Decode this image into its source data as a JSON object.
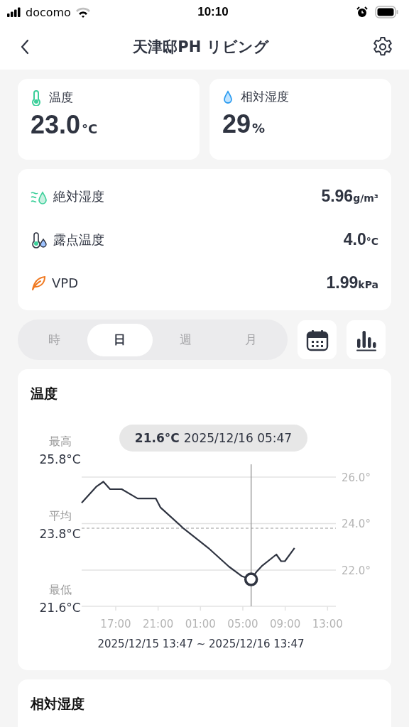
{
  "status_bar": {
    "carrier": "docomo",
    "time": "10:10"
  },
  "header": {
    "title": "天津邸PH リビング"
  },
  "summary_cards": [
    {
      "label": "温度",
      "value": "23.0",
      "unit": "°C"
    },
    {
      "label": "相対湿度",
      "value": "29",
      "unit": "%"
    }
  ],
  "details": [
    {
      "label": "絶対湿度",
      "value": "5.96",
      "unit": "g/m³"
    },
    {
      "label": "露点温度",
      "value": "4.0",
      "unit": "°C"
    },
    {
      "label": "VPD",
      "value": "1.99",
      "unit": "kPa"
    }
  ],
  "period_tabs": [
    {
      "label": "時",
      "selected": false
    },
    {
      "label": "日",
      "selected": true
    },
    {
      "label": "週",
      "selected": false
    },
    {
      "label": "月",
      "selected": false
    }
  ],
  "chart_card": {
    "stats": [
      {
        "label": "最高",
        "value": "25.8°C"
      },
      {
        "label": "平均",
        "value": "23.8°C"
      },
      {
        "label": "最低",
        "value": "21.6°C"
      }
    ],
    "chart_data": {
      "type": "line",
      "grid": true,
      "ylim": [
        20.44,
        26.55
      ],
      "xlim": [
        "2025-12-15T13:47",
        "2025-12-16T13:47"
      ],
      "xticks": [
        {
          "value": "2025-12-15T17:00",
          "label": "17:00"
        },
        {
          "value": "2025-12-15T21:00",
          "label": "21:00"
        },
        {
          "value": "2025-12-16T01:00",
          "label": "01:00"
        },
        {
          "value": "2025-12-16T05:00",
          "label": "05:00"
        },
        {
          "value": "2025-12-16T09:00",
          "label": "09:00"
        },
        {
          "value": "2025-12-16T13:00",
          "label": "13:00"
        }
      ],
      "yticks": [
        {
          "value": 22,
          "label": "22.0°"
        },
        {
          "value": 24,
          "label": "24.0°"
        },
        {
          "value": 26,
          "label": "26.0°"
        }
      ],
      "x": [
        "2025-12-15T13:47",
        "2025-12-15T15:12",
        "2025-12-15T15:50",
        "2025-12-15T16:28",
        "2025-12-15T17:34",
        "2025-12-15T19:04",
        "2025-12-15T20:47",
        "2025-12-15T21:14",
        "2025-12-15T23:26",
        "2025-12-16T01:44",
        "2025-12-16T03:41",
        "2025-12-16T04:56",
        "2025-12-16T05:47",
        "2025-12-16T06:19",
        "2025-12-16T06:47",
        "2025-12-16T08:10",
        "2025-12-16T08:37",
        "2025-12-16T08:58",
        "2025-12-16T09:53"
      ],
      "series": [
        {
          "name": "温度",
          "color": "#2f3441",
          "values": [
            24.89,
            25.6,
            25.8,
            25.48,
            25.48,
            25.08,
            25.08,
            24.69,
            23.78,
            22.95,
            22.15,
            21.73,
            21.6,
            21.94,
            22.17,
            22.67,
            22.38,
            22.38,
            22.95
          ]
        }
      ],
      "ref_lines": [
        {
          "axis": "y",
          "value": 23.8
        },
        {
          "axis": "x",
          "value": "2025-12-16T05:47"
        }
      ],
      "annotations": [
        "21.6°C"
      ]
    },
    "tooltip_time": "2025/12/16 05:47",
    "range": "2025/12/15 13:47 ~ 2025/12/16 13:47"
  },
  "next_card": {
    "title": "相対湿度"
  }
}
